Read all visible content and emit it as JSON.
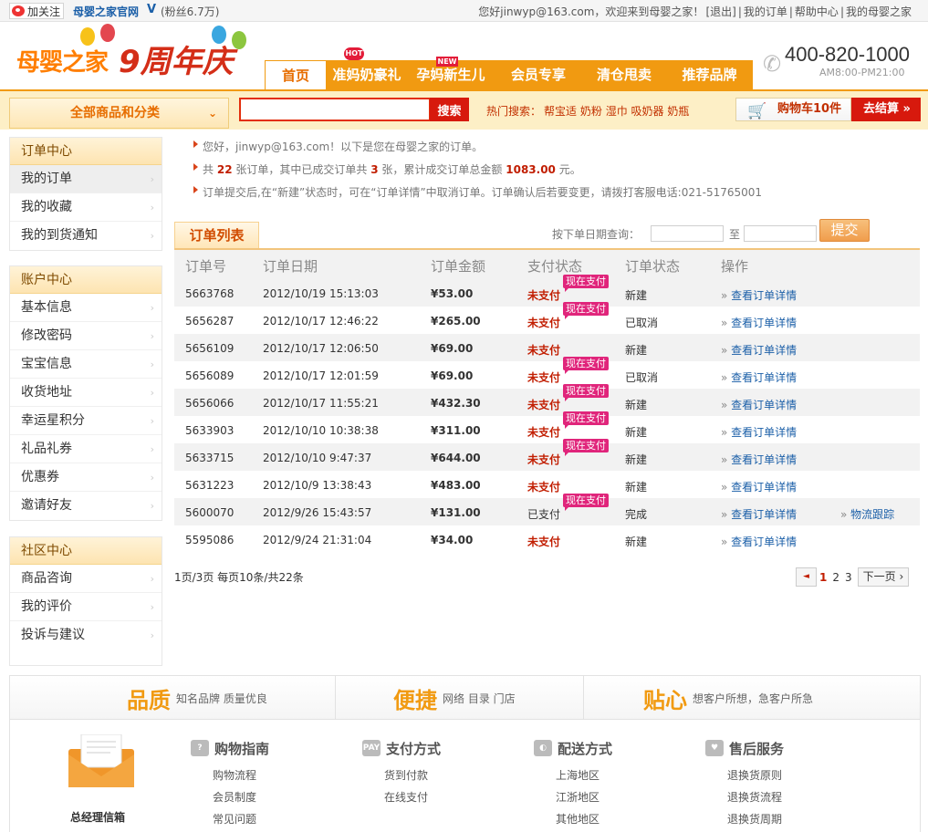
{
  "topbar": {
    "follow_label": "加关注",
    "official_label": "母婴之家官网",
    "verified_mark": "V",
    "fans_label": "(粉丝6.7万)",
    "welcome": "您好jinwyp@163.com，欢迎来到母婴之家！",
    "logout": "[退出]",
    "my_orders": "我的订单",
    "help": "帮助中心",
    "my_home": "我的母婴之家"
  },
  "header": {
    "logo_text": "母婴之家",
    "anniversary_text": "9周年庆",
    "nav": [
      "首页",
      "准妈奶豪礼",
      "孕妈新生儿",
      "会员专享",
      "清仓甩卖",
      "推荐品牌"
    ],
    "hot_tag": "HOT",
    "new_tag": "NEW",
    "phone": "400-820-1000",
    "hours": "AM8:00-PM21:00"
  },
  "searchbar": {
    "all_categories": "全部商品和分类",
    "search_button": "搜索",
    "search_value": "",
    "hot_label": "热门搜索：",
    "hot_terms": [
      "帮宝适",
      "奶粉",
      "湿巾",
      "吸奶器",
      "奶瓶"
    ],
    "cart_label": "购物车10件",
    "checkout_label": "去结算 »"
  },
  "sidebar": {
    "sections": [
      {
        "title": "订单中心",
        "items": [
          "我的订单",
          "我的收藏",
          "我的到货通知"
        ]
      },
      {
        "title": "账户中心",
        "items": [
          "基本信息",
          "修改密码",
          "宝宝信息",
          "收货地址",
          "幸运星积分",
          "礼品礼券",
          "优惠券",
          "邀请好友"
        ]
      },
      {
        "title": "社区中心",
        "items": [
          "商品咨询",
          "我的评价",
          "投诉与建议"
        ]
      }
    ]
  },
  "notices": {
    "line1_pre": "您好，",
    "line1_user": "jinwyp@163.com",
    "line1_post": "！以下是您在母婴之家的订单。",
    "line2_a": "共",
    "line2_total": "22",
    "line2_b": "张订单，其中已成交订单共",
    "line2_done": "3",
    "line2_c": "张，累计成交订单总金额",
    "line2_amount": "1083.00",
    "line2_d": "元。",
    "line3": "订单提交后,在“新建”状态时，可在“订单详情”中取消订单。订单确认后若要变更，请拨打客服电话:021-51765001"
  },
  "orders": {
    "tab_label": "订单列表",
    "date_query_label": "按下单日期查询：",
    "date_to_label": "至",
    "date_from": "",
    "date_to": "",
    "submit_label": "提交",
    "headers": [
      "订单号",
      "订单日期",
      "订单金额",
      "支付状态",
      "订单状态",
      "操作"
    ],
    "pay_now_label": "现在支付",
    "detail_label": "查看订单详情",
    "tracking_label": "物流跟踪",
    "rows": [
      {
        "id": "5663768",
        "date": "2012/10/19 15:13:03",
        "amount": "¥53.00",
        "pay": "未支付",
        "status": "新建"
      },
      {
        "id": "5656287",
        "date": "2012/10/17 12:46:22",
        "amount": "¥265.00",
        "pay": "未支付",
        "status": "已取消"
      },
      {
        "id": "5656109",
        "date": "2012/10/17 12:06:50",
        "amount": "¥69.00",
        "pay": "未支付",
        "status": "新建"
      },
      {
        "id": "5656089",
        "date": "2012/10/17 12:01:59",
        "amount": "¥69.00",
        "pay": "未支付",
        "status": "已取消"
      },
      {
        "id": "5656066",
        "date": "2012/10/17 11:55:21",
        "amount": "¥432.30",
        "pay": "未支付",
        "status": "新建"
      },
      {
        "id": "5633903",
        "date": "2012/10/10 10:38:38",
        "amount": "¥311.00",
        "pay": "未支付",
        "status": "新建"
      },
      {
        "id": "5633715",
        "date": "2012/10/10 9:47:37",
        "amount": "¥644.00",
        "pay": "未支付",
        "status": "新建"
      },
      {
        "id": "5631223",
        "date": "2012/10/9 13:38:43",
        "amount": "¥483.00",
        "pay": "未支付",
        "status": "新建"
      },
      {
        "id": "5600070",
        "date": "2012/9/26 15:43:57",
        "amount": "¥131.00",
        "pay": "已支付",
        "status": "完成"
      },
      {
        "id": "5595086",
        "date": "2012/9/24 21:31:04",
        "amount": "¥34.00",
        "pay": "未支付",
        "status": "新建"
      }
    ]
  },
  "pager": {
    "info": "1页/3页 每页10条/共22条",
    "prev": "◄",
    "pages": [
      "1",
      "2",
      "3"
    ],
    "next": "下一页 ›"
  },
  "footer": {
    "features": [
      {
        "big": "品质",
        "small": "知名品牌 质量优良"
      },
      {
        "big": "便捷",
        "small": "网络  目录  门店"
      },
      {
        "big": "贴心",
        "small": "想客户所想，急客户所急"
      }
    ],
    "gm_letter": "总经理信箱",
    "columns": [
      {
        "title": "购物指南",
        "links": [
          "购物流程",
          "会员制度",
          "常见问题"
        ]
      },
      {
        "title": "支付方式",
        "links": [
          "货到付款",
          "在线支付"
        ]
      },
      {
        "title": "配送方式",
        "links": [
          "上海地区",
          "江浙地区",
          "其他地区"
        ]
      },
      {
        "title": "售后服务",
        "links": [
          "退换货原则",
          "退换货流程",
          "退换货周期"
        ]
      }
    ]
  }
}
